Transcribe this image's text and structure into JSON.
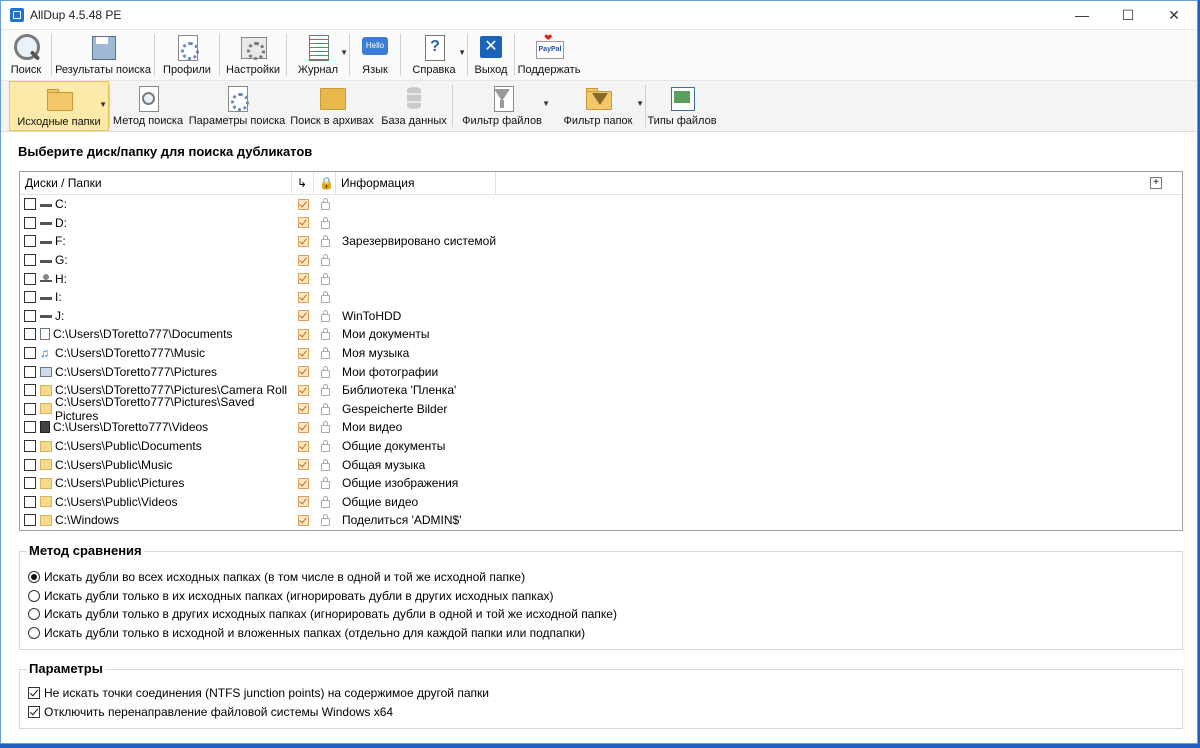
{
  "window": {
    "title": "AllDup 4.5.48 PE"
  },
  "toolbar_main": [
    {
      "label": "Поиск",
      "icon": "search-icon"
    },
    {
      "label": "Результаты поиска",
      "icon": "results-icon"
    },
    {
      "label": "Профили",
      "icon": "profiles-icon"
    },
    {
      "label": "Настройки",
      "icon": "settings-icon"
    },
    {
      "label": "Журнал",
      "icon": "log-icon",
      "dropdown": true
    },
    {
      "label": "Язык",
      "icon": "language-icon",
      "badge": "Hello"
    },
    {
      "label": "Справка",
      "icon": "help-icon",
      "dropdown": true
    },
    {
      "label": "Выход",
      "icon": "exit-icon"
    },
    {
      "label": "Поддержать",
      "icon": "paypal-icon",
      "badge": "PayPal"
    }
  ],
  "toolbar_sub": [
    {
      "label": "Исходные папки",
      "icon": "source-folders-icon",
      "active": true,
      "dropdown": true
    },
    {
      "label": "Метод поиска",
      "icon": "search-method-icon"
    },
    {
      "label": "Параметры поиска",
      "icon": "search-params-icon"
    },
    {
      "label": "Поиск в архивах",
      "icon": "archive-search-icon"
    },
    {
      "label": "База данных",
      "icon": "database-icon"
    },
    {
      "label": "Фильтр файлов",
      "icon": "file-filter-icon",
      "dropdown": true
    },
    {
      "label": "Фильтр папок",
      "icon": "folder-filter-icon",
      "dropdown": true
    },
    {
      "label": "Типы файлов",
      "icon": "file-types-icon"
    }
  ],
  "source": {
    "title": "Выберите диск/папку для поиска дубликатов",
    "columns": {
      "path": "Диски / Папки",
      "info": "Информация"
    },
    "rows": [
      {
        "path": "C:",
        "info": "",
        "icon": "system-drive-icon"
      },
      {
        "path": "D:",
        "info": "",
        "icon": "drive-icon"
      },
      {
        "path": "F:",
        "info": "Зарезервировано системой",
        "icon": "drive-icon"
      },
      {
        "path": "G:",
        "info": "",
        "icon": "drive-icon"
      },
      {
        "path": "H:",
        "info": "",
        "icon": "network-drive-icon"
      },
      {
        "path": "I:",
        "info": "",
        "icon": "drive-icon"
      },
      {
        "path": "J:",
        "info": "WinToHDD",
        "icon": "drive-icon"
      },
      {
        "path": "C:\\Users\\DToretto777\\Documents",
        "info": "Мои документы",
        "icon": "documents-icon"
      },
      {
        "path": "C:\\Users\\DToretto777\\Music",
        "info": "Моя музыка",
        "icon": "music-icon"
      },
      {
        "path": "C:\\Users\\DToretto777\\Pictures",
        "info": "Мои фотографии",
        "icon": "pictures-icon"
      },
      {
        "path": "C:\\Users\\DToretto777\\Pictures\\Camera Roll",
        "info": "Библиотека 'Пленка'",
        "icon": "folder-icon"
      },
      {
        "path": "C:\\Users\\DToretto777\\Pictures\\Saved Pictures",
        "info": "Gespeicherte Bilder",
        "icon": "folder-icon"
      },
      {
        "path": "C:\\Users\\DToretto777\\Videos",
        "info": "Мои видео",
        "icon": "videos-icon"
      },
      {
        "path": "C:\\Users\\Public\\Documents",
        "info": "Общие документы",
        "icon": "folder-icon"
      },
      {
        "path": "C:\\Users\\Public\\Music",
        "info": "Общая музыка",
        "icon": "folder-icon"
      },
      {
        "path": "C:\\Users\\Public\\Pictures",
        "info": "Общие изображения",
        "icon": "folder-icon"
      },
      {
        "path": "C:\\Users\\Public\\Videos",
        "info": "Общие видео",
        "icon": "folder-icon"
      },
      {
        "path": "C:\\Windows",
        "info": "Поделиться 'ADMIN$'",
        "icon": "folder-icon"
      }
    ]
  },
  "method": {
    "title": "Метод сравнения",
    "options": [
      {
        "label": "Искать дубли во всех исходных папках (в том числе в одной и той же исходной папке)",
        "selected": true
      },
      {
        "label": "Искать дубли только в их исходных папках (игнорировать дубли в других исходных папках)",
        "selected": false
      },
      {
        "label": "Искать дубли только в других исходных папках (игнорировать дубли в одной и той же исходной папке)",
        "selected": false
      },
      {
        "label": "Искать дубли только в исходной и вложенных папках (отдельно для каждой папки или подпапки)",
        "selected": false
      }
    ]
  },
  "params": {
    "title": "Параметры",
    "options": [
      {
        "label": "Не искать точки соединения (NTFS junction points) на содержимое другой папки",
        "checked": true
      },
      {
        "label": "Отключить перенаправление файловой системы Windows x64",
        "checked": true
      }
    ]
  }
}
